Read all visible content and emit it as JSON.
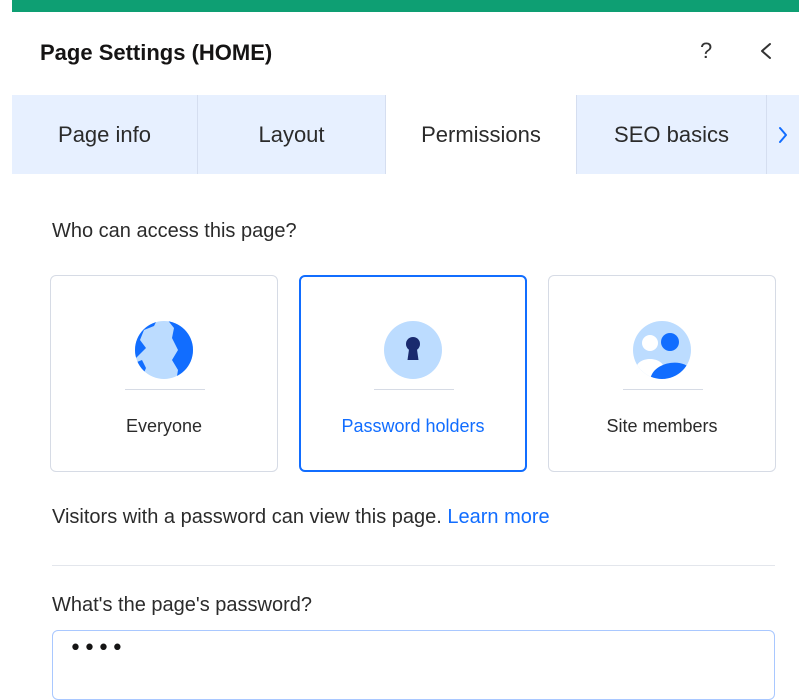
{
  "header": {
    "title": "Page Settings (HOME)",
    "help_label": "?"
  },
  "tabs": [
    {
      "label": "Page info",
      "active": false
    },
    {
      "label": "Layout",
      "active": false
    },
    {
      "label": "Permissions",
      "active": true
    },
    {
      "label": "SEO basics",
      "active": false
    }
  ],
  "permissions": {
    "question": "Who can access this page?",
    "options": [
      {
        "label": "Everyone",
        "icon": "globe-icon",
        "selected": false
      },
      {
        "label": "Password holders",
        "icon": "keyhole-icon",
        "selected": true
      },
      {
        "label": "Site members",
        "icon": "members-icon",
        "selected": false
      }
    ],
    "description": "Visitors with a password can view this page.",
    "learn_more": "Learn more"
  },
  "password": {
    "label": "What's the page's password?",
    "value": "••••"
  },
  "colors": {
    "accent": "#116dff",
    "top_bar": "#0e9f73",
    "tab_background": "#e7f0ff",
    "icon_light": "#bcdcff"
  }
}
